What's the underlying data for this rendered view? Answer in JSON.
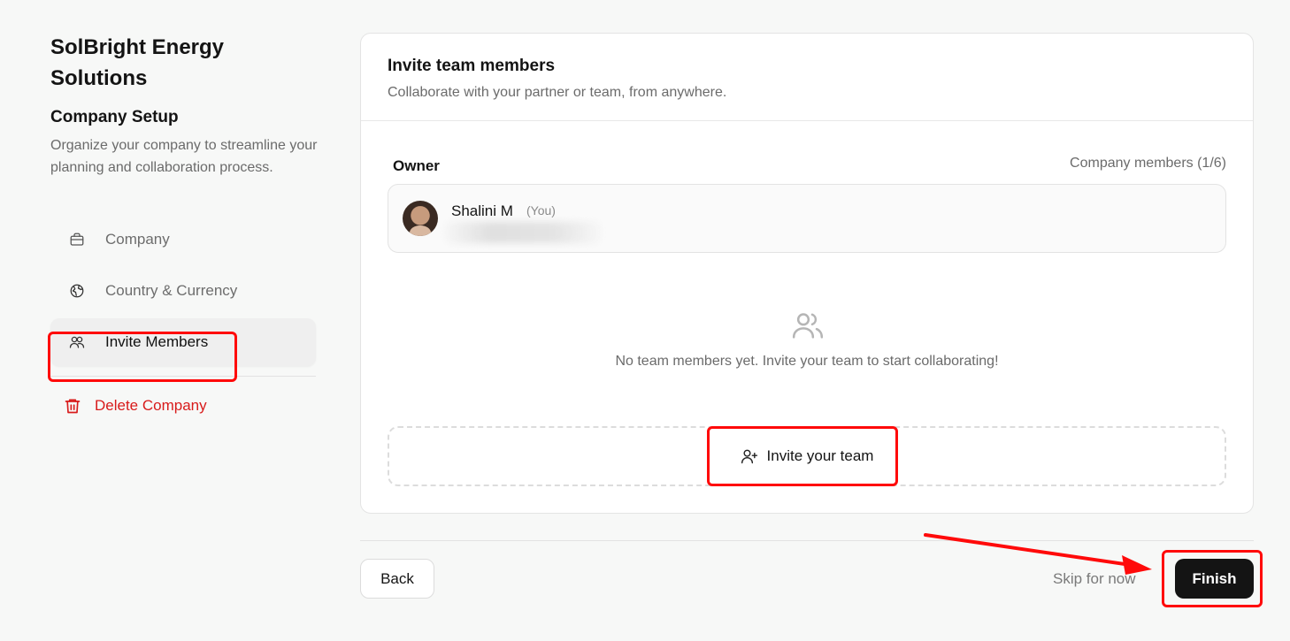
{
  "sidebar": {
    "company_name": "SolBright Energy Solutions",
    "section_title": "Company Setup",
    "section_desc": "Organize your company to streamline your planning and collaboration process.",
    "nav_items": [
      {
        "label": "Company",
        "icon": "briefcase-icon"
      },
      {
        "label": "Country & Currency",
        "icon": "globe-icon"
      },
      {
        "label": "Invite Members",
        "icon": "users-icon",
        "active": true
      }
    ],
    "delete_label": "Delete Company",
    "delete_color": "#d81b1b"
  },
  "card": {
    "title": "Invite team members",
    "subtitle": "Collaborate with your partner or team, from anywhere.",
    "owner_label": "Owner",
    "members_count": "Company members (1/6)",
    "owner": {
      "name": "Shalini M",
      "tag": "(You)"
    },
    "empty_text": "No team members yet. Invite your team to start collaborating!",
    "invite_label": "Invite your team"
  },
  "footer": {
    "back_label": "Back",
    "skip_label": "Skip for now",
    "finish_label": "Finish"
  },
  "colors": {
    "annotation": "#ff0a0a",
    "primary_button": "#141414"
  }
}
